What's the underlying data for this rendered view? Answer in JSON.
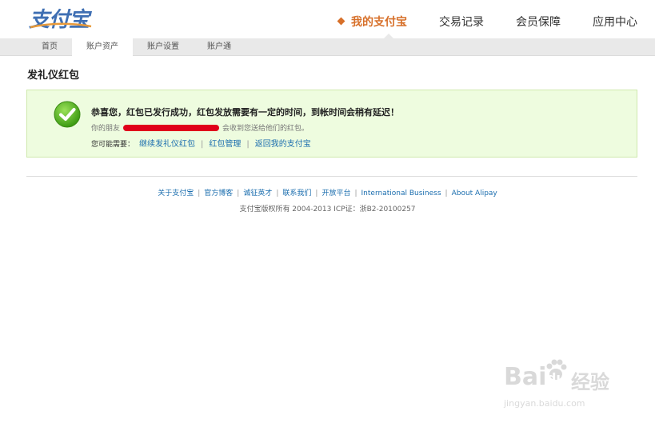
{
  "header": {
    "logo_text": "支付宝",
    "nav": [
      {
        "label": "我的支付宝",
        "active": true
      },
      {
        "label": "交易记录",
        "active": false
      },
      {
        "label": "会员保障",
        "active": false
      },
      {
        "label": "应用中心",
        "active": false
      }
    ]
  },
  "subnav": [
    {
      "label": "首页",
      "active": false
    },
    {
      "label": "账户资产",
      "active": true
    },
    {
      "label": "账户设置",
      "active": false
    },
    {
      "label": "账户通",
      "active": false
    }
  ],
  "page_title": "发礼仪红包",
  "success": {
    "title": "恭喜您，红包已发行成功，红包发放需要有一定的时间，到帐时间会稍有延迟！",
    "detail_prefix": "你的朋友",
    "detail_suffix": "会收到您送给他们的红包。",
    "actions_label": "您可能需要：",
    "actions": [
      "继续发礼仪红包",
      "红包管理",
      "返回我的支付宝"
    ]
  },
  "footer": {
    "links": [
      "关于支付宝",
      "官方博客",
      "诚征英才",
      "联系我们",
      "开放平台",
      "International Business",
      "About Alipay"
    ],
    "copyright": "支付宝版权所有 2004-2013 ICP证：浙B2-20100257"
  },
  "watermark": {
    "brand": "Bai",
    "brand2": "du",
    "cn": "经验",
    "url": "jingyan.baidu.com"
  },
  "colors": {
    "accent": "#d7702a",
    "link": "#1a6dae",
    "success_bg": "#eefcdf",
    "success_border": "#cfe9ae"
  }
}
